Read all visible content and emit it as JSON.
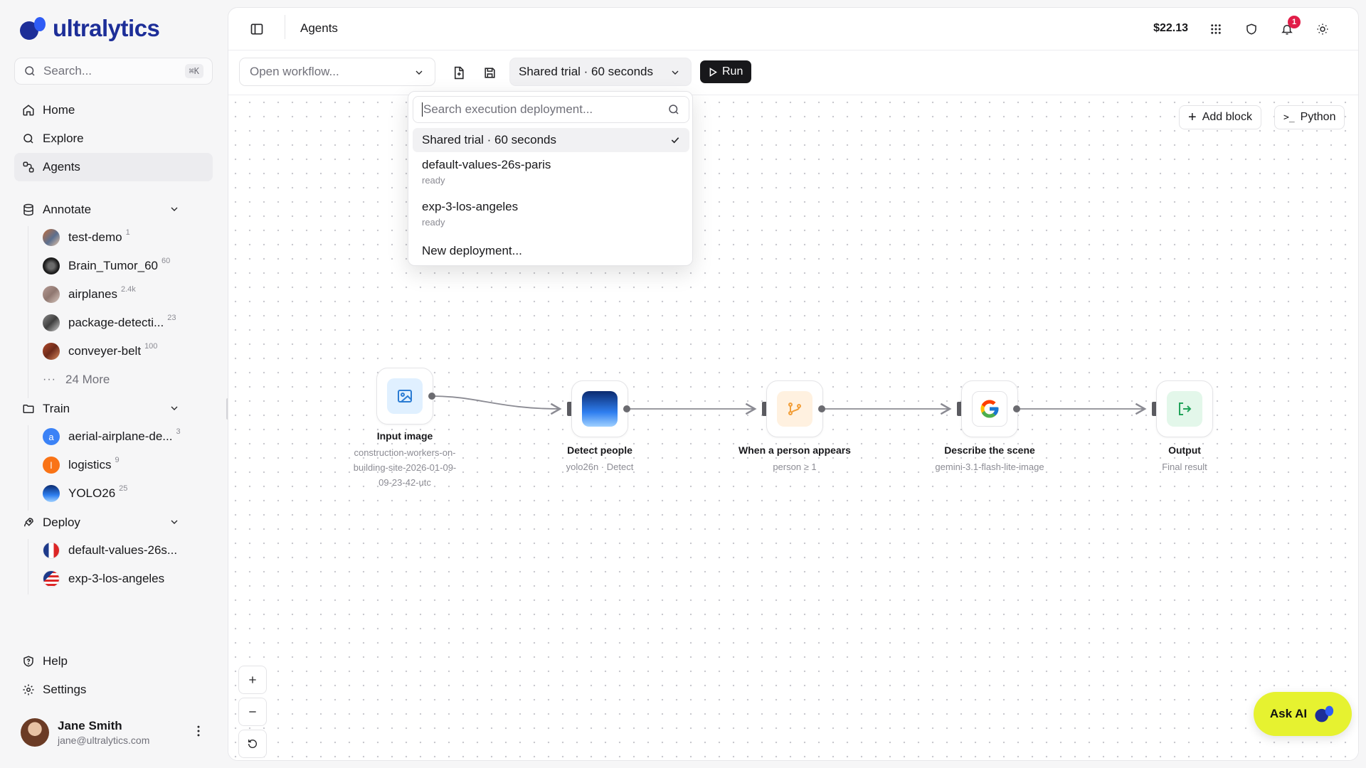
{
  "app": {
    "brand": "ultralytics",
    "brand_color": "#1d2e98",
    "accent_yellow": "#e6f230"
  },
  "sidebar": {
    "search": {
      "placeholder": "Search...",
      "shortcut": "⌘K"
    },
    "nav": [
      {
        "label": "Home",
        "icon": "home-icon"
      },
      {
        "label": "Explore",
        "icon": "search-icon"
      },
      {
        "label": "Agents",
        "icon": "agents-icon",
        "active": true
      }
    ],
    "annotate": {
      "label": "Annotate",
      "items": [
        {
          "label": "test-demo",
          "count": "1"
        },
        {
          "label": "Brain_Tumor_60",
          "count": "60"
        },
        {
          "label": "airplanes",
          "count": "2.4k"
        },
        {
          "label": "package-detecti...",
          "count": "23"
        },
        {
          "label": "conveyer-belt",
          "count": "100"
        }
      ],
      "more": "24 More"
    },
    "train": {
      "label": "Train",
      "items": [
        {
          "label": "aerial-airplane-de...",
          "count": "3",
          "initial": "a"
        },
        {
          "label": "logistics",
          "count": "9",
          "initial": "l"
        },
        {
          "label": "YOLO26",
          "count": "25"
        }
      ]
    },
    "deploy": {
      "label": "Deploy",
      "items": [
        {
          "label": "default-values-26s..."
        },
        {
          "label": "exp-3-los-angeles"
        }
      ]
    },
    "footer": [
      {
        "label": "Help"
      },
      {
        "label": "Settings"
      }
    ],
    "user": {
      "name": "Jane Smith",
      "email": "jane@ultralytics.com"
    }
  },
  "topbar": {
    "title": "Agents",
    "balance": "$22.13",
    "notifications": "1"
  },
  "toolbar": {
    "workflow_placeholder": "Open workflow...",
    "deployment": "Shared trial · 60 seconds",
    "run": "Run"
  },
  "canvas": {
    "add_block": "Add block",
    "python": "Python",
    "nodes": [
      {
        "title": "Input image",
        "sub": "construction-workers-on-building-site-2026-01-09-09-23-42-utc",
        "sub_lines": [
          "construction-workers-on-",
          "building-site-2026-01-09-",
          "09-23-42-utc"
        ]
      },
      {
        "title": "Detect people",
        "sub": "yolo26n · Detect"
      },
      {
        "title": "When a person appears",
        "sub": "person ≥ 1"
      },
      {
        "title": "Describe the scene",
        "sub": "gemini-3.1-flash-lite-image"
      },
      {
        "title": "Output",
        "sub": "Final result"
      }
    ]
  },
  "dropdown": {
    "search_placeholder": "Search execution deployment...",
    "items": [
      {
        "label": "Shared trial · 60 seconds",
        "selected": true
      },
      {
        "label": "default-values-26s-paris",
        "status": "ready"
      },
      {
        "label": "exp-3-los-angeles",
        "status": "ready"
      },
      {
        "label": "New deployment..."
      }
    ]
  },
  "ask_ai": "Ask AI"
}
